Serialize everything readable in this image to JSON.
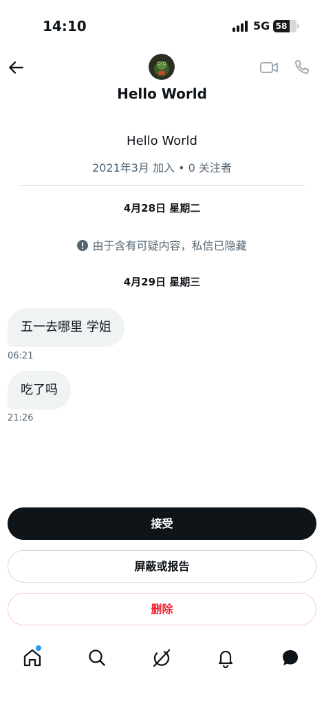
{
  "status_bar": {
    "time": "14:10",
    "network": "5G",
    "battery": "58",
    "icons": [
      "signal-icon",
      "battery-icon"
    ]
  },
  "header": {
    "title": "Hello World",
    "icons": [
      "back-arrow-icon",
      "avatar",
      "video-call-icon",
      "phone-icon"
    ]
  },
  "profile": {
    "name": "Hello World",
    "meta": "2021年3月 加入 • 0 关注者"
  },
  "conversation": {
    "date_1": "4月28日 星期二",
    "hidden_notice": "由于含有可疑内容，私信已隐藏",
    "notice_icon": "alert-icon",
    "date_2": "4月29日 星期三",
    "messages": [
      {
        "text": "五一去哪里 学姐",
        "time": "06:21"
      },
      {
        "text": "吃了吗",
        "time": "21:26"
      }
    ]
  },
  "actions": {
    "accept": "接受",
    "block_report": "屏蔽或报告",
    "delete": "删除"
  },
  "bottom_nav": {
    "items": [
      "home-icon",
      "search-icon",
      "grok-icon",
      "notifications-icon",
      "messages-icon"
    ],
    "accent": "#1d9bf0"
  },
  "colors": {
    "primary_text": "#0f1419",
    "secondary_text": "#536471",
    "bubble": "#eff3f4",
    "danger": "#f4212e"
  }
}
